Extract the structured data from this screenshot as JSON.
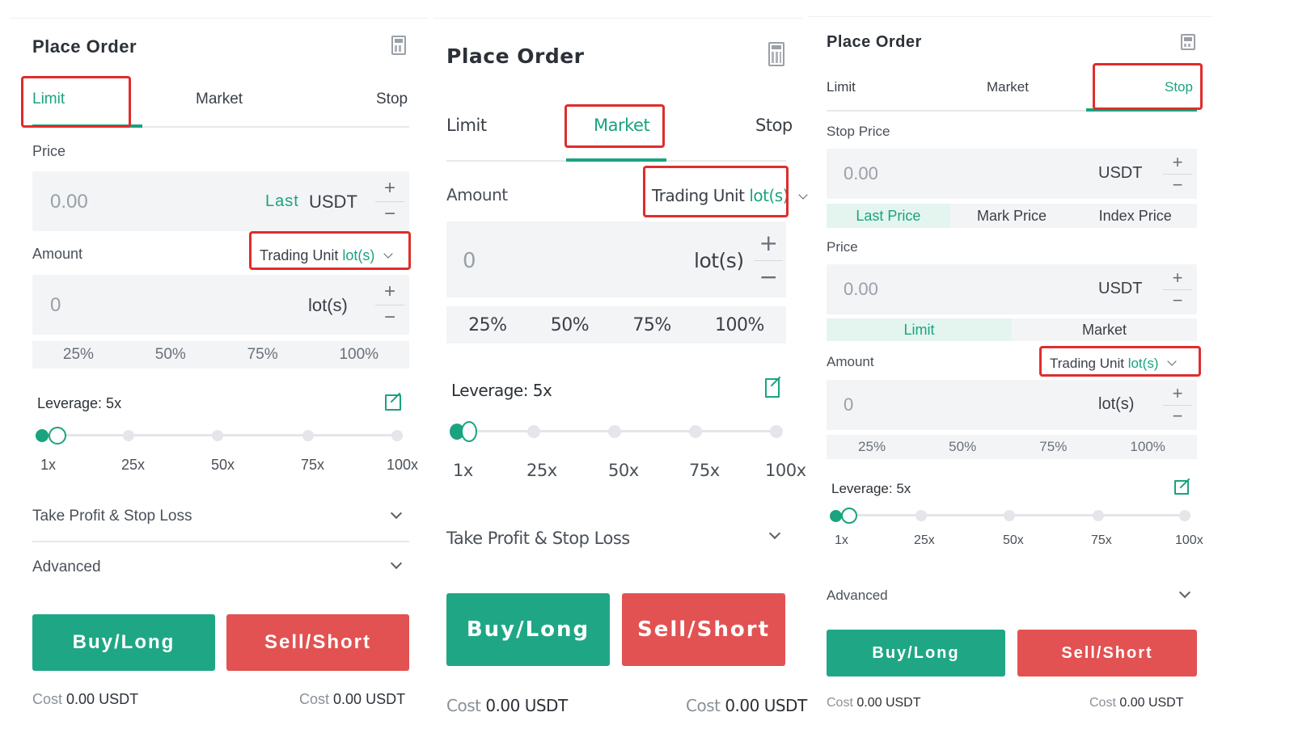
{
  "panels": [
    {
      "title": "Place Order",
      "tabs": [
        "Limit",
        "Market",
        "Stop"
      ],
      "active_tab": "Limit",
      "price_label": "Price",
      "price_placeholder": "0.00",
      "last_label": "Last",
      "currency": "USDT",
      "amount_label": "Amount",
      "trading_unit_prefix": "Trading Unit",
      "trading_unit_suffix": "lot(s)",
      "amount_placeholder": "0",
      "amount_unit": "lot(s)",
      "percentages": [
        "25%",
        "50%",
        "75%",
        "100%"
      ],
      "leverage_label": "Leverage: 5x",
      "leverage_level_fraction": 0.04,
      "leverage_ticks": [
        "1x",
        "25x",
        "50x",
        "75x",
        "100x"
      ],
      "tpsl_label": "Take Profit & Stop Loss",
      "advanced_label": "Advanced",
      "buy_label": "Buy/Long",
      "sell_label": "Sell/Short",
      "cost_label": "Cost",
      "cost_value": "0.00 USDT"
    },
    {
      "title": "Place Order",
      "tabs": [
        "Limit",
        "Market",
        "Stop"
      ],
      "active_tab": "Market",
      "amount_label": "Amount",
      "trading_unit_prefix": "Trading Unit",
      "trading_unit_suffix": "lot(s)",
      "amount_placeholder": "0",
      "amount_unit": "lot(s)",
      "percentages": [
        "25%",
        "50%",
        "75%",
        "100%"
      ],
      "leverage_label": "Leverage: 5x",
      "leverage_level_fraction": 0.04,
      "leverage_ticks": [
        "1x",
        "25x",
        "50x",
        "75x",
        "100x"
      ],
      "tpsl_label": "Take Profit & Stop Loss",
      "buy_label": "Buy/Long",
      "sell_label": "Sell/Short",
      "cost_label": "Cost",
      "cost_value": "0.00 USDT"
    },
    {
      "title": "Place Order",
      "tabs": [
        "Limit",
        "Market",
        "Stop"
      ],
      "active_tab": "Stop",
      "stop_price_label": "Stop Price",
      "stop_price_placeholder": "0.00",
      "currency": "USDT",
      "price_types": [
        "Last Price",
        "Mark Price",
        "Index Price"
      ],
      "active_price_type": "Last Price",
      "price_label": "Price",
      "price_placeholder": "0.00",
      "order_types": [
        "Limit",
        "Market"
      ],
      "active_order_type": "Limit",
      "amount_label": "Amount",
      "trading_unit_prefix": "Trading Unit",
      "trading_unit_suffix": "lot(s)",
      "amount_placeholder": "0",
      "amount_unit": "lot(s)",
      "percentages": [
        "25%",
        "50%",
        "75%",
        "100%"
      ],
      "leverage_label": "Leverage: 5x",
      "leverage_level_fraction": 0.04,
      "leverage_ticks": [
        "1x",
        "25x",
        "50x",
        "75x",
        "100x"
      ],
      "advanced_label": "Advanced",
      "buy_label": "Buy/Long",
      "sell_label": "Sell/Short",
      "cost_label": "Cost",
      "cost_value": "0.00 USDT"
    }
  ],
  "colors": {
    "accent": "#1aa37f",
    "buy": "#1fa785",
    "sell": "#e25252",
    "highlight_box": "#e02c2c"
  }
}
